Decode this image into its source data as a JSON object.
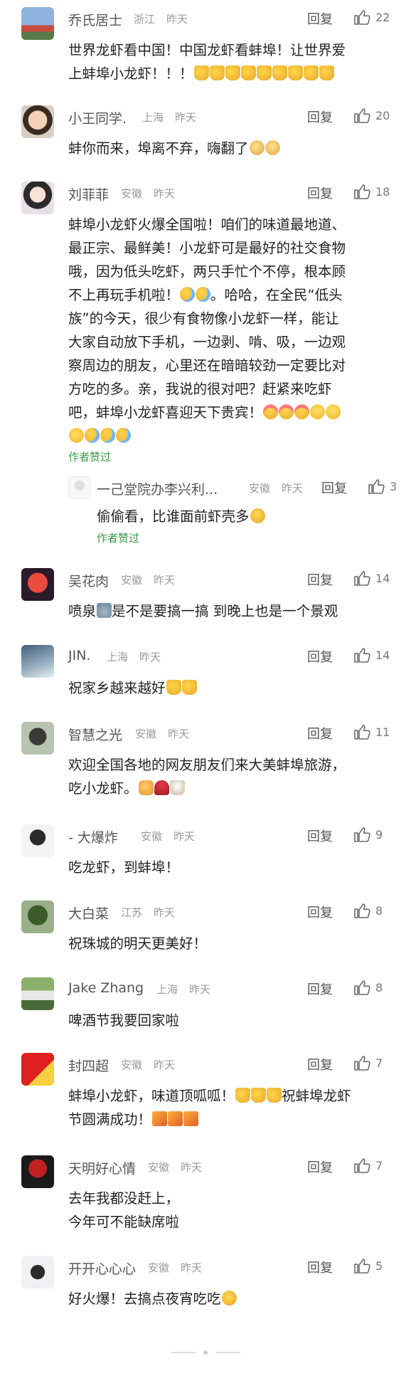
{
  "labels": {
    "reply": "回复",
    "author_liked": "作者赞过"
  },
  "colors": {
    "badge_green": "#3a9a4a",
    "name_gray": "#555555",
    "loc_gray": "#9a9a9a"
  },
  "comments": [
    {
      "name": "乔氏居士",
      "location": "浙江",
      "time": "昨天",
      "likes": "22",
      "lines": [
        {
          "text": "世界龙虾看中国！中国龙虾看蚌埠！让世界爱",
          "emojis": []
        },
        {
          "text": "上蚌埠小龙虾！！！",
          "emojis": [
            "thumbs-up",
            "thumbs-up",
            "thumbs-up",
            "thumbs-up",
            "thumbs-up",
            "thumbs-up",
            "thumbs-up",
            "thumbs-up",
            "thumbs-up"
          ]
        }
      ]
    },
    {
      "name": "小王同学.",
      "location": "上海",
      "time": "昨天",
      "likes": "20",
      "lines": [
        {
          "text": "蚌你而来，埠离不弃，嗨翻了",
          "emojis": [
            "cat-face",
            "cat-face"
          ]
        }
      ]
    },
    {
      "name": "刘菲菲",
      "location": "安徽",
      "time": "昨天",
      "likes": "18",
      "lines": [
        {
          "text": "蚌埠小龙虾火爆全国啦！咱们的味道最地道、",
          "emojis": []
        },
        {
          "text": "最正宗、最鲜美！小龙虾可是最好的社交食物",
          "emojis": []
        },
        {
          "text": "哦，因为低头吃虾，两只手忙个不停，根本顾",
          "emojis": []
        },
        {
          "text": "不上再玩手机啦！",
          "emojis": [
            "laugh-cry",
            "laugh-cry"
          ],
          "after": "。哈哈，在全民“低头"
        },
        {
          "text": "族”的今天，很少有食物像小龙虾一样，能让",
          "emojis": []
        },
        {
          "text": "大家自动放下手机，一边剥、啃、吸，一边观",
          "emojis": []
        },
        {
          "text": "察周边的朋友，心里还在暗暗较劲一定要比对",
          "emojis": []
        },
        {
          "text": "方吃的多。亲，我说的很对吧？赶紧来吃虾",
          "emojis": []
        },
        {
          "text": "吧，蚌埠小龙虾喜迎天下贵宾！",
          "emojis": [
            "party-face",
            "party-face",
            "party-face",
            "grin",
            "grin"
          ]
        },
        {
          "text": "",
          "emojis": [
            "grin",
            "laugh-cry",
            "laugh-cry",
            "laugh-cry"
          ]
        }
      ],
      "author_liked": true,
      "reply": {
        "name": "一己堂院办李兴利...",
        "location": "安徽",
        "time": "昨天",
        "likes": "3",
        "text": "偷偷看，比谁面前虾壳多",
        "emojis": [
          "thinking"
        ],
        "author_liked": true
      }
    },
    {
      "name": "吴花肉",
      "location": "安徽",
      "time": "昨天",
      "likes": "14",
      "lines": [
        {
          "text": "喷泉",
          "emojis": [
            "fountain"
          ],
          "after": "是不是要搞一搞 到晚上也是一个景观"
        }
      ]
    },
    {
      "name": "JIN.",
      "location": "上海",
      "time": "昨天",
      "likes": "14",
      "lines": [
        {
          "text": "祝家乡越来越好",
          "emojis": [
            "thumbs-up",
            "thumbs-up"
          ]
        }
      ]
    },
    {
      "name": "智慧之光",
      "location": "安徽",
      "time": "昨天",
      "likes": "11",
      "lines": [
        {
          "text": "欢迎全国各地的网友朋友们来大美蚌埠旅游，",
          "emojis": []
        },
        {
          "text": "吃小龙虾。",
          "emojis": [
            "handshake",
            "rose",
            "coffee"
          ]
        }
      ]
    },
    {
      "name": "- 大爆炸",
      "location": "安徽",
      "time": "昨天",
      "likes": "9",
      "lines": [
        {
          "text": "吃龙虾，到蚌埠！",
          "emojis": []
        }
      ]
    },
    {
      "name": "大白菜",
      "location": "江苏",
      "time": "昨天",
      "likes": "8",
      "lines": [
        {
          "text": "祝珠城的明天更美好！",
          "emojis": []
        }
      ]
    },
    {
      "name": "Jake Zhang",
      "location": "上海",
      "time": "昨天",
      "likes": "8",
      "lines": [
        {
          "text": "啤酒节我要回家啦",
          "emojis": []
        }
      ]
    },
    {
      "name": "封四超",
      "location": "安徽",
      "time": "昨天",
      "likes": "7",
      "lines": [
        {
          "text": "蚌埠小龙虾，味道顶呱呱！",
          "emojis": [
            "thumbs-up",
            "thumbs-up",
            "thumbs-up"
          ],
          "after": "祝蚌埠龙虾"
        },
        {
          "text": "节圆满成功！",
          "emojis": [
            "party-popper",
            "party-popper",
            "party-popper"
          ]
        }
      ]
    },
    {
      "name": "天明好心情",
      "location": "安徽",
      "time": "昨天",
      "likes": "7",
      "lines": [
        {
          "text": "去年我都没赶上，",
          "emojis": []
        },
        {
          "text": "今年可不能缺席啦",
          "emojis": []
        }
      ]
    },
    {
      "name": "开开心心心",
      "location": "安徽",
      "time": "昨天",
      "likes": "5",
      "lines": [
        {
          "text": "好火爆！去搞点夜宵吃吃",
          "emojis": [
            "thinking"
          ]
        }
      ]
    }
  ]
}
